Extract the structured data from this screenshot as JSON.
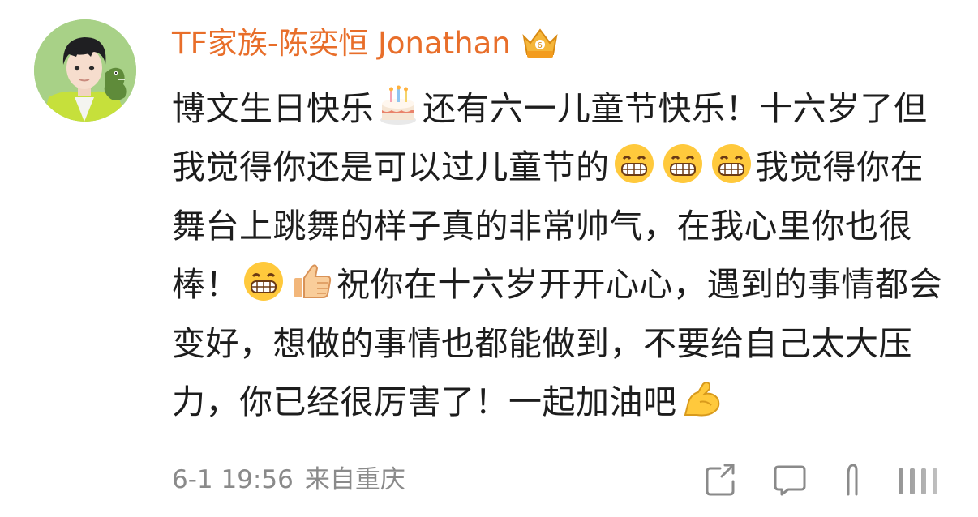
{
  "post": {
    "username": "TF家族-陈奕恒 Jonathan",
    "badge_icon": "vip-crown-icon",
    "text_segments": [
      "博文生日快乐",
      "还有六一儿童节快乐！十六岁了但我觉得你还是可以过儿童节的",
      "我觉得你在舞台上跳舞的样子真的非常帅气，在我心里你也很棒！",
      "祝你在十六岁开开心心，遇到的事情都会变好，想做的事情也都能做到，不要给自己太大压力，你已经很厉害了！一起加油吧"
    ],
    "emojis": [
      "birthday-cake-icon",
      "grin-icon",
      "grin-icon",
      "grin-icon",
      "grin-icon",
      "thumbs-up-icon",
      "flexed-biceps-icon"
    ],
    "timestamp": "6-1 19:56",
    "source": "来自重庆",
    "actions": [
      "share-icon",
      "comment-icon",
      "like-icon",
      "more-icon"
    ]
  },
  "colors": {
    "username": "#e86e2a",
    "text": "#1d1d1d",
    "meta": "#8a8a8a",
    "avatar_bg": "#a6cf84"
  }
}
